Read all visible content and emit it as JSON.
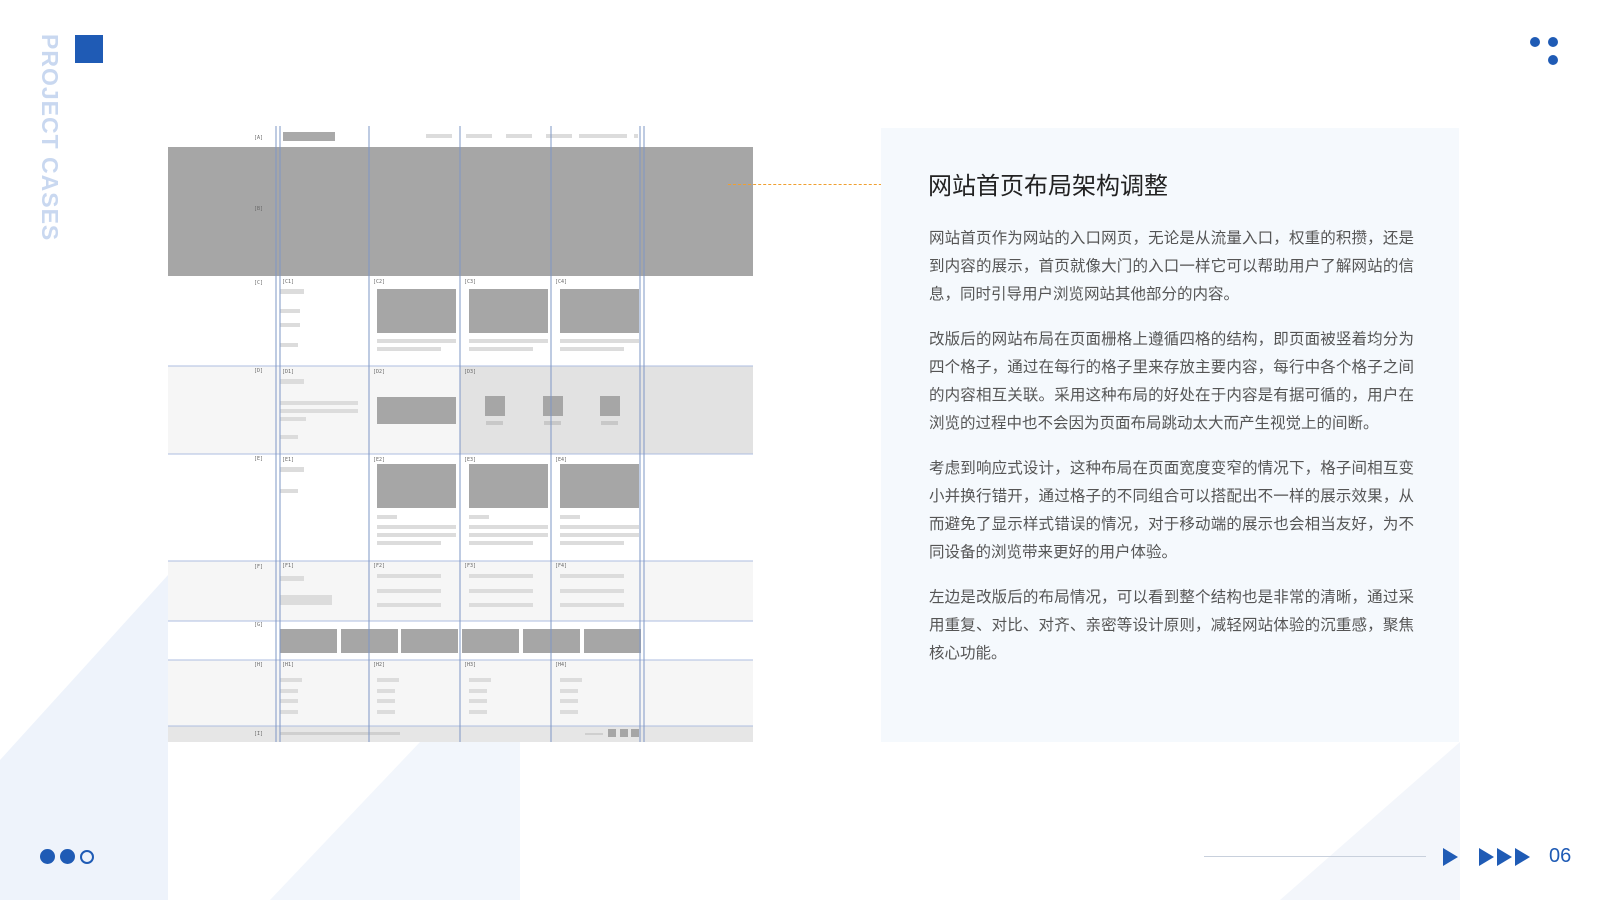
{
  "side_label": "PROJECT CASES",
  "colors": {
    "accent": "#1f5bb5",
    "connector": "#f09a1a",
    "panel_bg": "#f5f9fd"
  },
  "wireframe": {
    "row_labels": [
      "[A]",
      "[B]",
      "[C]",
      "[D]",
      "[E]",
      "[F]",
      "[G]",
      "[H]",
      "[I]"
    ],
    "row_c": [
      "[C1]",
      "[C2]",
      "[C3]",
      "[C4]"
    ],
    "row_d": [
      "[D1]",
      "[D2]",
      "[D3]"
    ],
    "row_e": [
      "[E1]",
      "[E2]",
      "[E3]",
      "[E4]"
    ],
    "row_f": [
      "[F1]",
      "[F2]",
      "[F3]",
      "[F4]"
    ],
    "row_h": [
      "[H1]",
      "[H2]",
      "[H3]",
      "[H4]"
    ]
  },
  "panel": {
    "title": "网站首页布局架构调整",
    "paragraphs": [
      "网站首页作为网站的入口网页，无论是从流量入口，权重的积攒，还是到内容的展示，首页就像大门的入口一样它可以帮助用户了解网站的信息，同时引导用户浏览网站其他部分的内容。",
      "改版后的网站布局在页面栅格上遵循四格的结构，即页面被竖着均分为四个格子，通过在每行的格子里来存放主要内容，每行中各个格子之间的内容相互关联。采用这种布局的好处在于内容是有据可循的，用户在浏览的过程中也不会因为页面布局跳动太大而产生视觉上的间断。",
      "考虑到响应式设计，这种布局在页面宽度变窄的情况下，格子间相互变小并换行错开，通过格子的不同组合可以搭配出不一样的展示效果，从而避免了显示样式错误的情况，对于移动端的展示也会相当友好，为不同设备的浏览带来更好的用户体验。",
      "左边是改版后的布局情况，可以看到整个结构也是非常的清晰，通过采用重复、对比、对齐、亲密等设计原则，减轻网站体验的沉重感，聚焦核心功能。"
    ]
  },
  "footer": {
    "page_number": "06"
  }
}
